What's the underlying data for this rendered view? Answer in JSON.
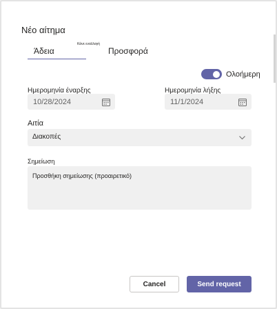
{
  "dialog": {
    "title": "Νέο αίτημα"
  },
  "tabs": {
    "leave": "Άδεια",
    "swap_small": "Κάνε εναλλαγή",
    "offer": "Προσφορά"
  },
  "toggle": {
    "label": "Ολοήμερη",
    "on": true
  },
  "start": {
    "label": "Ημερομηνία έναρξης",
    "value": "10/28/2024"
  },
  "end": {
    "label": "Ημερομηνία λήξης",
    "value": "11/1/2024"
  },
  "reason": {
    "label": "Αιτία",
    "value": "Διακοπές"
  },
  "note": {
    "label": "Σημείωση",
    "placeholder": "Προσθήκη σημείωσης (προαιρετικό)"
  },
  "actions": {
    "cancel": "Cancel",
    "send": "Send request"
  },
  "colors": {
    "accent": "#6264a7"
  },
  "icons": {
    "calendar": "calendar-icon",
    "chevron": "chevron-down-icon"
  }
}
